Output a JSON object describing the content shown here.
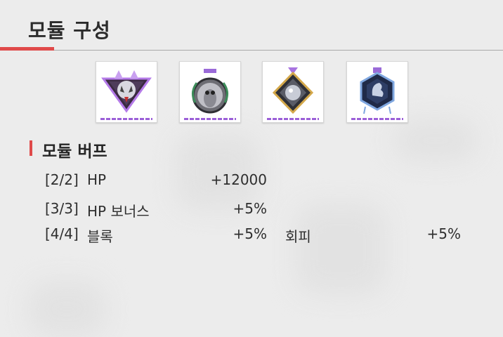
{
  "header": {
    "title": "모듈 구성"
  },
  "modules": [
    {
      "icon": "demon-wolf-emblem-icon"
    },
    {
      "icon": "owl-medal-icon"
    },
    {
      "icon": "crystal-diamond-medal-icon"
    },
    {
      "icon": "hexagon-knight-emblem-icon"
    }
  ],
  "buff_section": {
    "title": "모듈 버프",
    "rows": [
      {
        "step": "[2/2]",
        "stat": "HP",
        "value": "+12000"
      },
      {
        "step": "[3/3]",
        "stat": "HP 보너스",
        "value": "+5%"
      },
      {
        "step": "[4/4]",
        "stat": "블록",
        "value": "+5%",
        "stat2": "회피",
        "value2": "+5%"
      }
    ]
  },
  "colors": {
    "accent": "#e04a4a",
    "module_rarity": "#9b5fd8"
  }
}
